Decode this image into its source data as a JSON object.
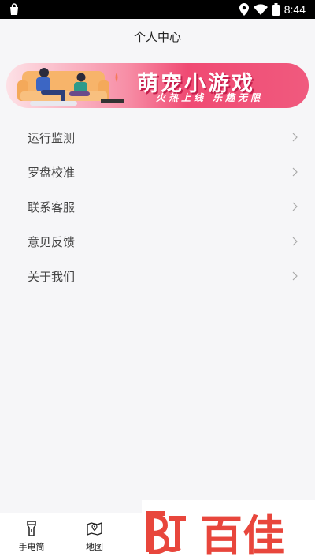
{
  "status_bar": {
    "time": "8:44",
    "icons": [
      "shopping-bag-icon",
      "location-pin-icon",
      "wifi-icon",
      "battery-icon"
    ]
  },
  "header": {
    "title": "个人中心"
  },
  "banner": {
    "title": "萌宠小游戏",
    "subtitle": "火热上线 乐趣无限",
    "colors": {
      "start": "#fde1e6",
      "end": "#f05a7e",
      "shadow": "#c6204d"
    }
  },
  "menu": {
    "items": [
      {
        "label": "运行监测"
      },
      {
        "label": "罗盘校准"
      },
      {
        "label": "联系客服"
      },
      {
        "label": "意见反馈"
      },
      {
        "label": "关于我们"
      }
    ]
  },
  "tabbar": {
    "items": [
      {
        "label": "手电筒",
        "icon": "flashlight-icon"
      },
      {
        "label": "地图",
        "icon": "map-icon"
      }
    ]
  },
  "watermark": {
    "text": "百佳",
    "color": "#e8463c"
  }
}
